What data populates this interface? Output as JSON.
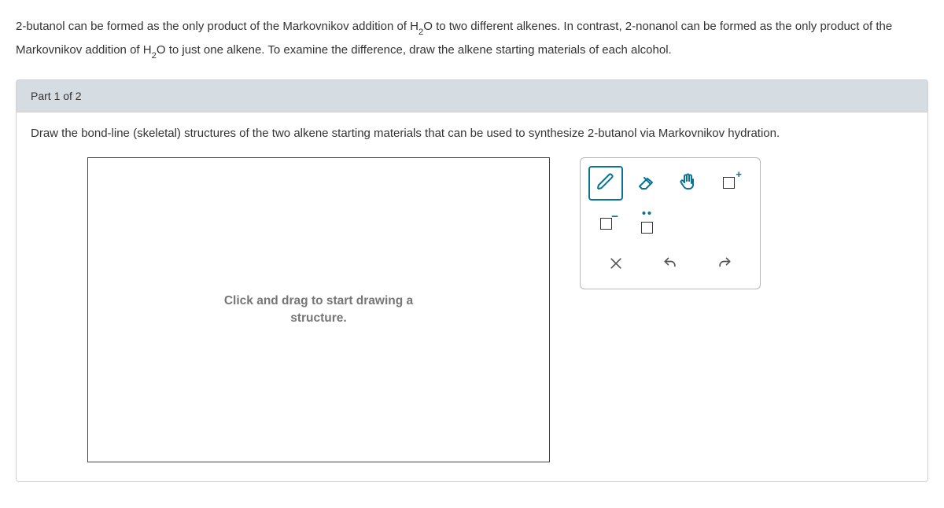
{
  "intro": {
    "seg1": "2-butanol can be formed as the only product of the Markovnikov addition of ",
    "formula1_base": "H",
    "formula1_sub": "2",
    "formula1_tail": "O",
    "seg2": " to two different alkenes. In contrast, 2-nonanol can be formed as the only product of the Markovnikov addition of ",
    "formula2_base": "H",
    "formula2_sub": "2",
    "formula2_tail": "O",
    "seg3": " to just one alkene. To examine the difference, draw the alkene starting materials of each alcohol."
  },
  "panel": {
    "header": "Part 1 of 2",
    "instruction": "Draw the bond-line (skeletal) structures of the two alkene starting materials that can be used to synthesize 2-butanol via Markovnikov hydration."
  },
  "canvas": {
    "placeholder_line1": "Click and drag to start drawing a",
    "placeholder_line2": "structure."
  },
  "tools": {
    "draw": "draw",
    "erase": "erase",
    "move": "move",
    "add_box": "add",
    "anion": "anion",
    "lone_pair": "lone-pair"
  },
  "actions": {
    "clear": "clear",
    "undo": "undo",
    "redo": "redo"
  }
}
